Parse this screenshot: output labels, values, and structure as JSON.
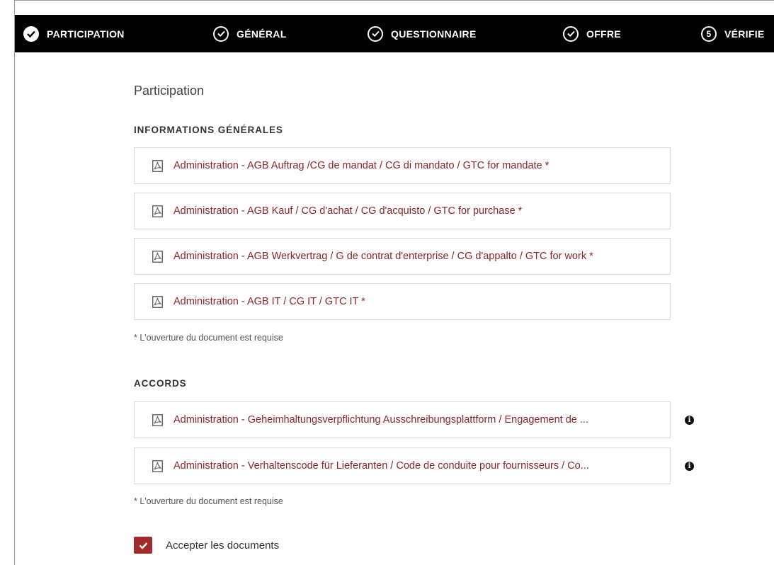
{
  "stepper": {
    "steps": [
      {
        "label": "PARTICIPATION",
        "state": "complete",
        "icon": "check-filled-icon"
      },
      {
        "label": "GÉNÉRAL",
        "state": "complete",
        "icon": "check-circle-icon"
      },
      {
        "label": "QUESTIONNAIRE",
        "state": "complete",
        "icon": "check-circle-icon"
      },
      {
        "label": "OFFRE",
        "state": "complete",
        "icon": "check-circle-icon"
      },
      {
        "number": "5",
        "label": "VÉRIFIE",
        "state": "current"
      }
    ]
  },
  "page": {
    "title": "Participation"
  },
  "general_info": {
    "title": "INFORMATIONS GÉNÉRALES",
    "documents": [
      {
        "label": "Administration - AGB Auftrag /CG de mandat / CG di mandato / GTC for mandate *"
      },
      {
        "label": "Administration - AGB Kauf / CG d'achat / CG d'acquisto / GTC for purchase *"
      },
      {
        "label": "Administration - AGB Werkvertrag / G de contrat d'enterprise / CG d'appalto / GTC for work *"
      },
      {
        "label": "Administration - AGB IT / CG IT / GTC IT *"
      }
    ],
    "note": "* L'ouverture du document est requise"
  },
  "agreements": {
    "title": "ACCORDS",
    "documents": [
      {
        "label": "Administration - Geheimhaltungsverpflichtung Ausschreibungsplattform / Engagement de ..."
      },
      {
        "label": "Administration - Verhaltenscode für Lieferanten / Code de conduite pour fournisseurs / Co..."
      }
    ],
    "note": "* L'ouverture du document est requise"
  },
  "accept": {
    "label": "Accepter les documents",
    "checked": true
  },
  "colors": {
    "accent": "#a32a2a",
    "link": "#8b2525",
    "stepper_bg": "#000000"
  }
}
